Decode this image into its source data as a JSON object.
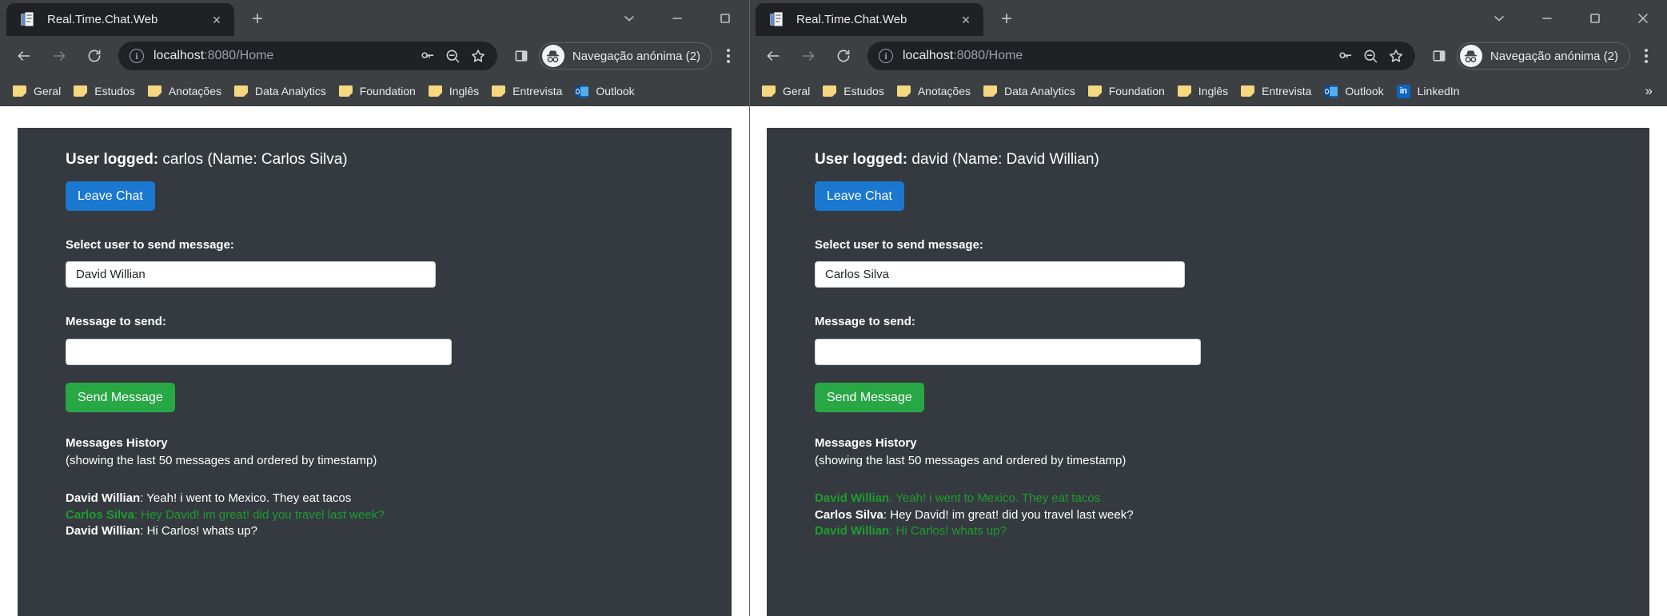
{
  "windows": [
    {
      "id": "left",
      "tab": {
        "title": "Real.Time.Chat.Web",
        "favicon": "document-icon",
        "close": "×"
      },
      "newtab_label": "+",
      "window_controls": [
        "chevron-down-icon",
        "minimize-icon",
        "maximize-icon"
      ],
      "toolbar": {
        "back": "back-icon",
        "forward": "forward-icon",
        "reload": "reload-icon",
        "info": "i",
        "url_host": "localhost",
        "url_path": ":8080/Home",
        "url_full": "localhost:8080/Home",
        "password_icon": "key-icon",
        "zoom_icon": "zoom-out-icon",
        "bookmark_icon": "star-icon",
        "side_panel_icon": "side-panel-icon",
        "profile_label": "Navegação anónima (2)",
        "profile_icon": "incognito-icon",
        "menu_icon": "kebab-menu-icon"
      },
      "bookmarks": [
        {
          "label": "Geral",
          "icon": "folder-icon"
        },
        {
          "label": "Estudos",
          "icon": "folder-icon"
        },
        {
          "label": "Anotações",
          "icon": "folder-icon"
        },
        {
          "label": "Data Analytics",
          "icon": "folder-icon"
        },
        {
          "label": "Foundation",
          "icon": "folder-icon"
        },
        {
          "label": "Inglês",
          "icon": "folder-icon"
        },
        {
          "label": "Entrevista",
          "icon": "folder-icon"
        },
        {
          "label": "Outlook",
          "icon": "outlook-icon"
        }
      ],
      "bookmarks_overflow": "",
      "page": {
        "user_logged_label": "User logged:",
        "user_logged_value": "carlos (Name: Carlos Silva)",
        "leave_chat_label": "Leave Chat",
        "select_user_label": "Select user to send message:",
        "select_user_value": "David Willian",
        "select_user_options": [
          "David Willian"
        ],
        "message_label": "Message to send:",
        "message_value": "",
        "message_placeholder": "",
        "send_label": "Send Message",
        "history_title": "Messages History",
        "history_subtitle": "(showing the last 50 messages and ordered by timestamp)",
        "messages": [
          {
            "sender": "David Willian",
            "text": "Yeah! i went to Mexico. They eat tacos",
            "own": false
          },
          {
            "sender": "Carlos Silva",
            "text": "Hey David! im great! did you travel last week?",
            "own": true
          },
          {
            "sender": "David Willian",
            "text": "Hi Carlos! whats up?",
            "own": false
          }
        ]
      }
    },
    {
      "id": "right",
      "tab": {
        "title": "Real.Time.Chat.Web",
        "favicon": "document-icon",
        "close": "×"
      },
      "newtab_label": "+",
      "window_controls": [
        "chevron-down-icon",
        "minimize-icon",
        "maximize-icon",
        "close-icon"
      ],
      "toolbar": {
        "back": "back-icon",
        "forward": "forward-icon",
        "reload": "reload-icon",
        "info": "i",
        "url_host": "localhost",
        "url_path": ":8080/Home",
        "url_full": "localhost:8080/Home",
        "password_icon": "key-icon",
        "zoom_icon": "zoom-out-icon",
        "bookmark_icon": "star-icon",
        "side_panel_icon": "side-panel-icon",
        "profile_label": "Navegação anónima (2)",
        "profile_icon": "incognito-icon",
        "menu_icon": "kebab-menu-icon"
      },
      "bookmarks": [
        {
          "label": "Geral",
          "icon": "folder-icon"
        },
        {
          "label": "Estudos",
          "icon": "folder-icon"
        },
        {
          "label": "Anotações",
          "icon": "folder-icon"
        },
        {
          "label": "Data Analytics",
          "icon": "folder-icon"
        },
        {
          "label": "Foundation",
          "icon": "folder-icon"
        },
        {
          "label": "Inglês",
          "icon": "folder-icon"
        },
        {
          "label": "Entrevista",
          "icon": "folder-icon"
        },
        {
          "label": "Outlook",
          "icon": "outlook-icon"
        },
        {
          "label": "LinkedIn",
          "icon": "linkedin-icon"
        }
      ],
      "bookmarks_overflow": "»",
      "page": {
        "user_logged_label": "User logged:",
        "user_logged_value": "david (Name: David Willian)",
        "leave_chat_label": "Leave Chat",
        "select_user_label": "Select user to send message:",
        "select_user_value": "Carlos Silva",
        "select_user_options": [
          "Carlos Silva"
        ],
        "message_label": "Message to send:",
        "message_value": "",
        "message_placeholder": "",
        "send_label": "Send Message",
        "history_title": "Messages History",
        "history_subtitle": "(showing the last 50 messages and ordered by timestamp)",
        "messages": [
          {
            "sender": "David Willian",
            "text": "Yeah! i went to Mexico. They eat tacos",
            "own": true
          },
          {
            "sender": "Carlos Silva",
            "text": "Hey David! im great! did you travel last week?",
            "own": false
          },
          {
            "sender": "David Willian",
            "text": "Hi Carlos! whats up?",
            "own": true
          }
        ]
      }
    }
  ],
  "colors": {
    "chrome_bg": "#3c4043",
    "tab_active": "#202124",
    "page_bg": "#343a40",
    "primary": "#1b78d0",
    "success": "#28a745",
    "own_message": "#1f9c2e",
    "bookmark_folder": "#f5d87f",
    "linkedin": "#0a66c2",
    "outlook": "#0f6cbd"
  },
  "linkedin_glyph": "in"
}
